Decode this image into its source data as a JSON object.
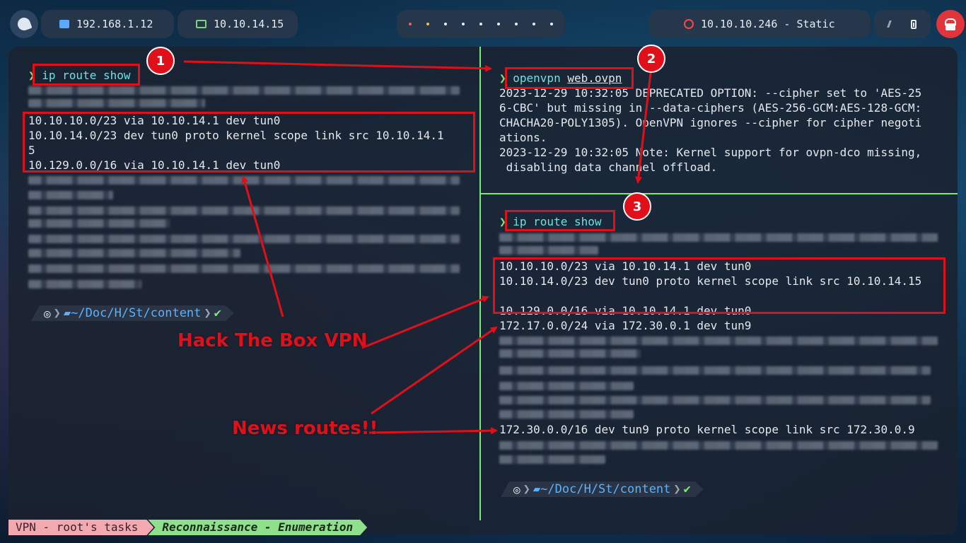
{
  "topbar": {
    "ip_local": "192.168.1.12",
    "ip_vpn": "10.10.14.15",
    "target": "10.10.10.246 - Static"
  },
  "left": {
    "cmd": "ip route show",
    "routes": [
      "10.10.10.0/23 via 10.10.14.1 dev tun0",
      "10.10.14.0/23 dev tun0 proto kernel scope link src 10.10.14.1",
      "5",
      "10.129.0.0/16 via 10.10.14.1 dev tun0"
    ],
    "prompt": {
      "home": "~",
      "path": "/Doc/H/St/",
      "dir": "content",
      "ok": "✔"
    }
  },
  "right_top": {
    "cmd": "openvpn",
    "arg": "web.ovpn",
    "output": [
      "2023-12-29 10:32:05 DEPRECATED OPTION: --cipher set to 'AES-25",
      "6-CBC' but missing in --data-ciphers (AES-256-GCM:AES-128-GCM:",
      "CHACHA20-POLY1305). OpenVPN ignores --cipher for cipher negoti",
      "ations.",
      "2023-12-29 10:32:05 Note: Kernel support for ovpn-dco missing,",
      " disabling data channel offload."
    ]
  },
  "right_bottom": {
    "cmd": "ip route show",
    "routes": [
      "10.10.10.0/23 via 10.10.14.1 dev tun0",
      "10.10.14.0/23 dev tun0 proto kernel scope link src 10.10.14.15",
      "10.129.0.0/16 via 10.10.14.1 dev tun0"
    ],
    "new_route_1": "172.17.0.0/24 via 172.30.0.1 dev tun9",
    "new_route_2": "172.30.0.0/16 dev tun9 proto kernel scope link src 172.30.0.9",
    "prompt": {
      "home": "~",
      "path": "/Doc/H/St/",
      "dir": "content",
      "ok": "✔"
    }
  },
  "statusbar": {
    "session": "VPN - root's tasks",
    "window": "Reconnaissance - Enumeration"
  },
  "annotations": {
    "badge1": "1",
    "badge2": "2",
    "badge3": "3",
    "label_vpn": "Hack The Box VPN",
    "label_routes": "News routes!!",
    "color": "#e0101a"
  },
  "icons": [
    "launcher-bird-icon",
    "network-icon",
    "laptop-icon",
    "target-icon",
    "mute-icon",
    "battery-icon",
    "lock-icon",
    "debian-icon",
    "folder-icon",
    "check-icon"
  ]
}
